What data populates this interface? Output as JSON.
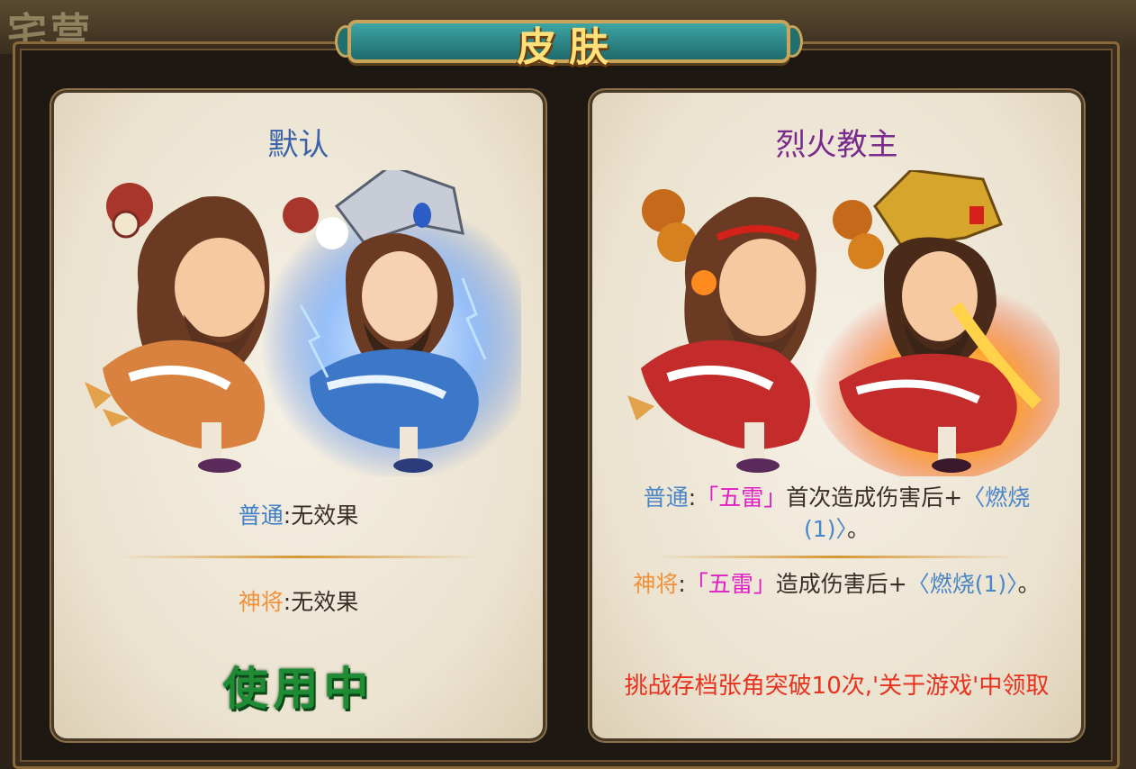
{
  "header": {
    "title": "皮肤",
    "bg_text": "宅营"
  },
  "skins": [
    {
      "name": "默认",
      "normal_label": "普通",
      "normal_effect": ":无效果",
      "god_label": "神将",
      "god_effect": ":无效果",
      "status": "使用中"
    },
    {
      "name": "烈火教主",
      "normal_label": "普通",
      "normal_sep": ":",
      "normal_skill": "「五雷」",
      "normal_text": "首次造成伤害后+",
      "normal_buff": "〈燃烧(1)〉",
      "normal_end": "。",
      "god_label": "神将",
      "god_sep": ":",
      "god_skill": "「五雷」",
      "god_text": "造成伤害后+",
      "god_buff": "〈燃烧(1)〉",
      "god_end": "。",
      "unlock_text": "挑战存档张角突破10次,'关于游戏'中领取"
    }
  ],
  "colors": {
    "normal": "#3f7fc8",
    "god": "#f2913c",
    "skill": "#e020c4",
    "unlock": "#e8321e",
    "in_use": "#1d8c34"
  },
  "icons": [
    "character-normal-art",
    "character-god-art"
  ]
}
